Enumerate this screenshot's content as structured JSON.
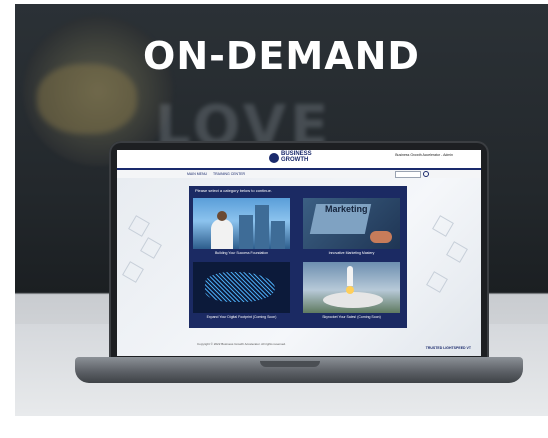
{
  "headline": "ON-DEMAND",
  "background": {
    "wall_word": "LOVE"
  },
  "site": {
    "logo_line1": "BUSINESS",
    "logo_line2": "GROWTH",
    "user_area": "Business Growth Accelerator - Admin",
    "nav": [
      "MAIN MENU",
      "TRAINING CENTER"
    ],
    "search_placeholder": "",
    "panel_title": "Please select a category below to continue.",
    "tiles": [
      {
        "label": "Building Your Success Foundation"
      },
      {
        "label": "Innovative Marketing Mastery",
        "image_word": "Marketing"
      },
      {
        "label": "Expand Your Digital Footprint (Coming Soon)"
      },
      {
        "label": "Skyrocket Your Sales! (Coming Soon)"
      }
    ],
    "footer_logo": "TRUSTED LIGHTSPEED VT",
    "footer_copy": "Copyright © 2022 Business Growth Accelerator. All rights reserved."
  },
  "colors": {
    "brand": "#1b2a63",
    "headline": "#ffffff"
  }
}
